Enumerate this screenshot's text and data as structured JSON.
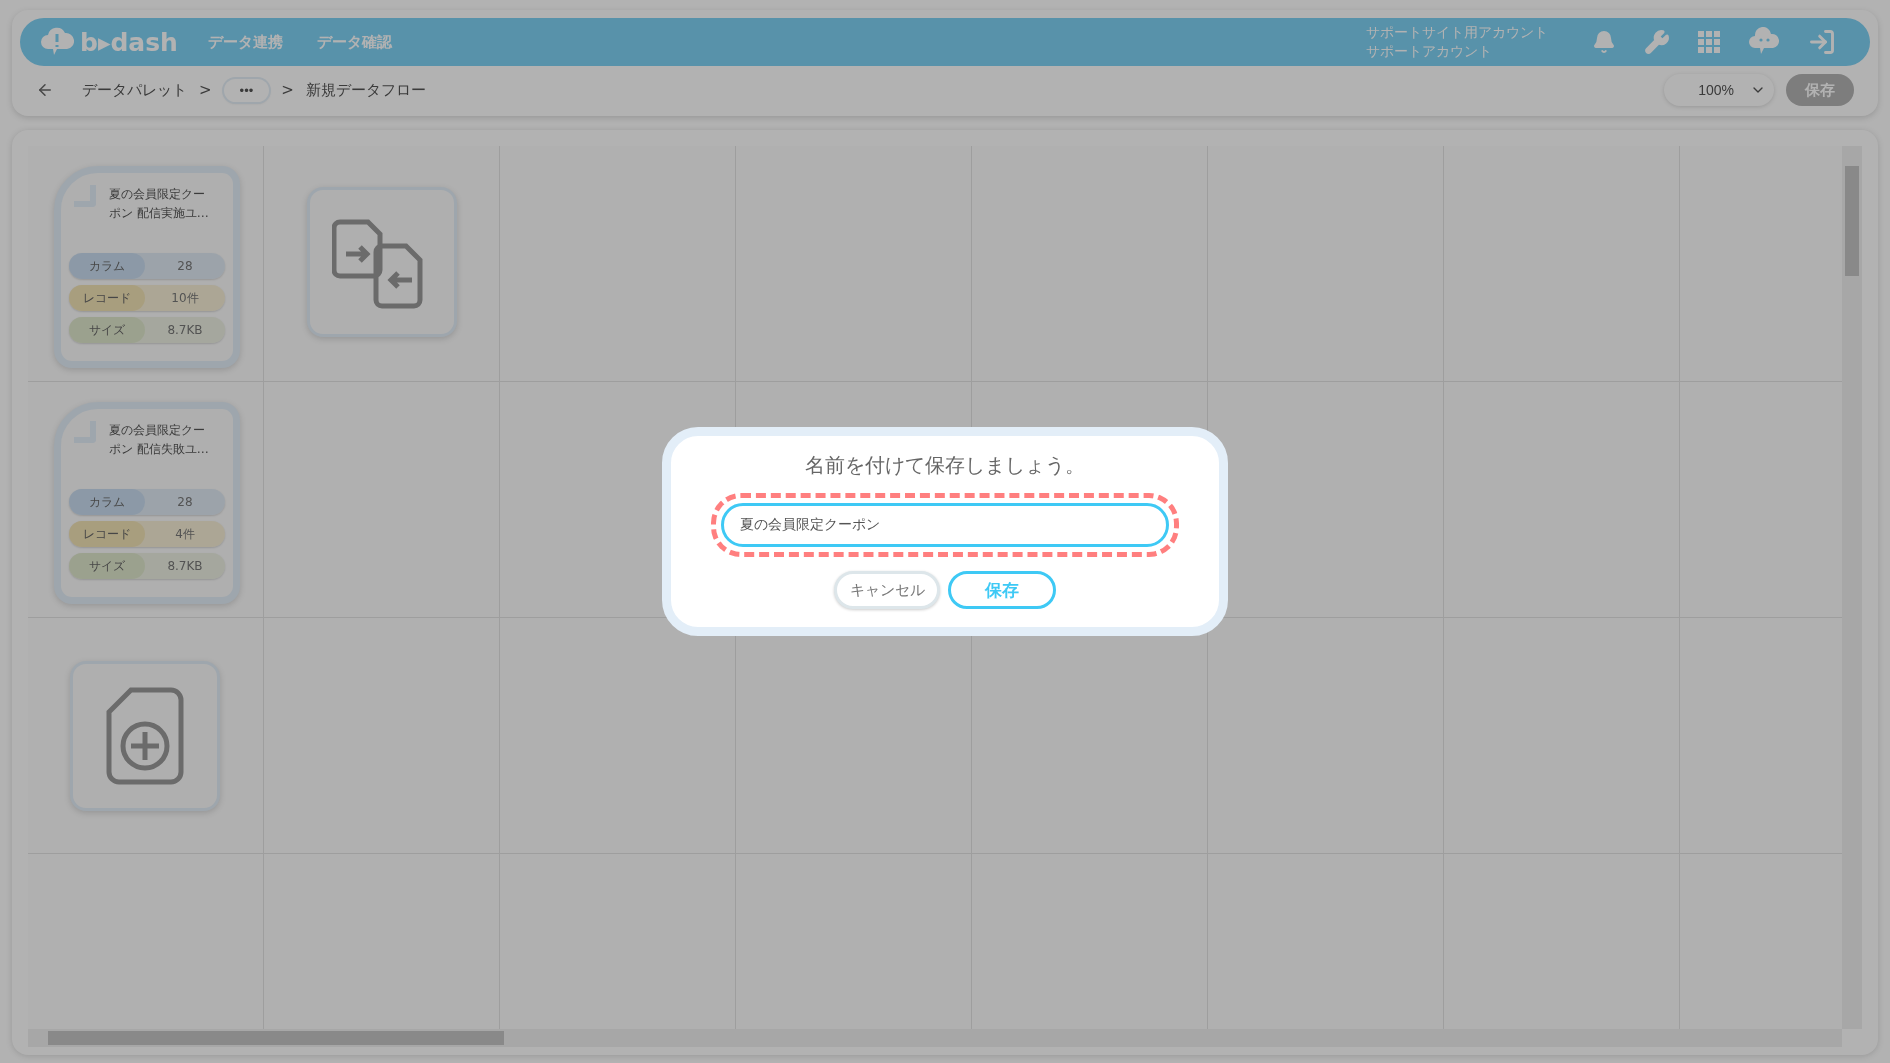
{
  "header": {
    "logo": "b▸dash",
    "nav": [
      {
        "label": "データ連携"
      },
      {
        "label": "データ確認"
      }
    ],
    "account": {
      "line_1": "サポートサイト用アカウント",
      "line_2": "サポートアカウント"
    }
  },
  "breadcrumb": {
    "items": [
      {
        "kind": "link",
        "label": "データパレット"
      },
      {
        "kind": "sep",
        "label": ">"
      },
      {
        "kind": "more",
        "label": "•••"
      },
      {
        "kind": "sep",
        "label": ">"
      },
      {
        "kind": "current",
        "label": "新規データフロー"
      }
    ]
  },
  "toolbar": {
    "zoom": "100%",
    "save": {
      "label": "保存",
      "disabled": true
    }
  },
  "nodes": [
    {
      "kind": "data",
      "title": "夏の会員限定クーポン 配信実施ユ…",
      "stats": [
        {
          "label": "カラム",
          "value": "28",
          "color": "#8d9aa7"
        },
        {
          "label": "レコード",
          "value": "10件",
          "color": "#a99e7f"
        },
        {
          "label": "サイズ",
          "value": "8.7KB",
          "color": "#9ca28f"
        }
      ]
    },
    {
      "kind": "transform"
    },
    {
      "kind": "data",
      "title": "夏の会員限定クーポン 配信失敗ユ…",
      "stats": [
        {
          "label": "カラム",
          "value": "28",
          "color": "#8d9aa7"
        },
        {
          "label": "レコード",
          "value": "4件",
          "color": "#a99e7f"
        },
        {
          "label": "サイズ",
          "value": "8.7KB",
          "color": "#9ca28f"
        }
      ]
    },
    {
      "kind": "add"
    }
  ],
  "dialog": {
    "title": "名前を付けて保存しましょう。",
    "input": {
      "value": "夏の会員限定クーポン",
      "highlighted": true
    },
    "cancel": "キャンセル",
    "save": "保存"
  }
}
